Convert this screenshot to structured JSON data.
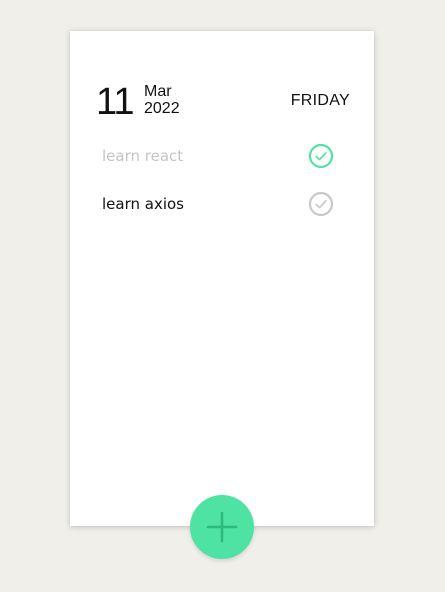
{
  "date": {
    "day": "11",
    "month": "Mar",
    "year": "2022",
    "weekday": "FRIDAY"
  },
  "todos": [
    {
      "text": "learn react",
      "done": true
    },
    {
      "text": "learn axios",
      "done": false
    }
  ],
  "colors": {
    "background": "#f0efea",
    "card": "#ffffff",
    "accent": "#4ee3a3",
    "done_check": "#4ee3a3",
    "pending_check": "#c8c8c8",
    "done_text": "#c4c4c4"
  },
  "icons": {
    "done_check": "check-circle-icon",
    "pending_check": "check-circle-icon",
    "add": "plus-icon"
  }
}
